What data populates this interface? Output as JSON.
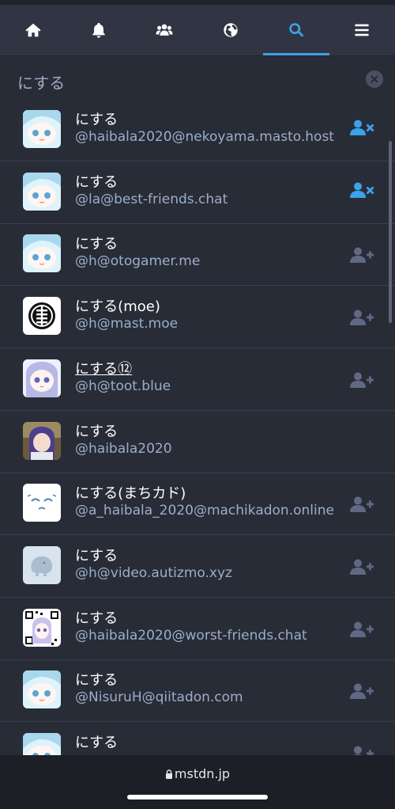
{
  "nav": {
    "tabs": [
      {
        "name": "home-icon",
        "active": false
      },
      {
        "name": "bell-icon",
        "active": false
      },
      {
        "name": "users-icon",
        "active": false
      },
      {
        "name": "globe-icon",
        "active": false
      },
      {
        "name": "search-icon",
        "active": true
      },
      {
        "name": "menu-icon",
        "active": false
      }
    ]
  },
  "search": {
    "value": "にする"
  },
  "accounts": [
    {
      "display_name": "にする",
      "handle": "@haibala2020@nekoyama.masto.host",
      "follow_state": "unfollow"
    },
    {
      "display_name": "にする",
      "handle": "@la@best-friends.chat",
      "follow_state": "unfollow"
    },
    {
      "display_name": "にする",
      "handle": "@h@otogamer.me",
      "follow_state": "follow"
    },
    {
      "display_name": "にする(moe)",
      "handle": "@h@mast.moe",
      "follow_state": "follow"
    },
    {
      "display_name": "にする⑫",
      "handle": "@h@toot.blue",
      "follow_state": "follow"
    },
    {
      "display_name": "にする",
      "handle": "@haibala2020",
      "follow_state": "none"
    },
    {
      "display_name": "にする(まちカド)",
      "handle": "@a_haibala_2020@machikadon.online",
      "follow_state": "follow"
    },
    {
      "display_name": "にする",
      "handle": "@h@video.autizmo.xyz",
      "follow_state": "follow"
    },
    {
      "display_name": "にする",
      "handle": "@haibala2020@worst-friends.chat",
      "follow_state": "follow"
    },
    {
      "display_name": "にする",
      "handle": "@NisuruH@qiitadon.com",
      "follow_state": "follow"
    },
    {
      "display_name": "にする",
      "handle": "",
      "follow_state": "follow"
    }
  ],
  "browser": {
    "url": "mstdn.jp"
  },
  "colors": {
    "background": "#282c37",
    "navbar": "#313543",
    "accent": "#3aa3e9",
    "secondary_text": "#9baec8",
    "follow_icon": "#606984"
  }
}
